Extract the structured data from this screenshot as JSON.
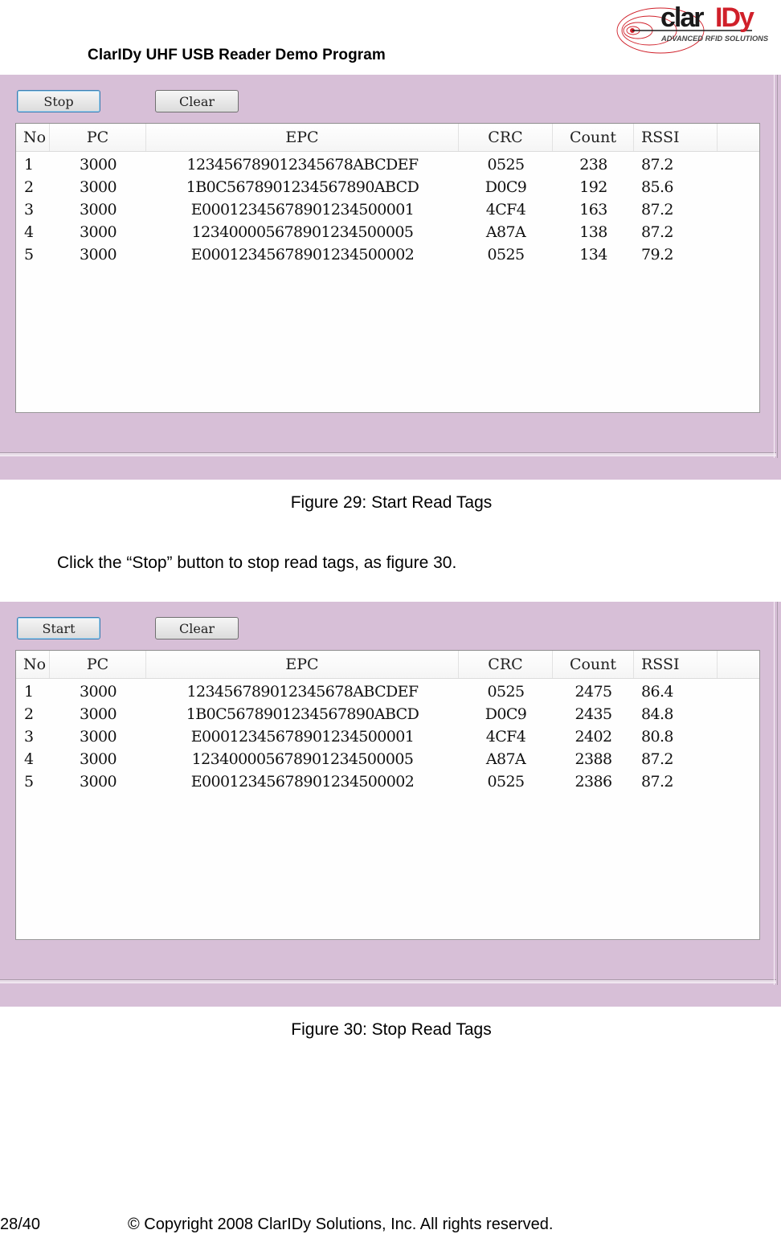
{
  "header": {
    "title": "ClarIDy UHF USB Reader Demo Program",
    "logo": {
      "brand_left": "clar",
      "brand_right": "IDy",
      "tagline": "ADVANCED RFID SOLUTIONS",
      "colors": {
        "dark": "#1a1a1a",
        "accent": "#d0202a"
      }
    }
  },
  "colors": {
    "panel_bg": "#d7bfd7",
    "primary_button_border": "#3c7fb1"
  },
  "table_columns": [
    "No",
    "PC",
    "EPC",
    "CRC",
    "Count",
    "RSSI",
    ""
  ],
  "figures": [
    {
      "toolbar": {
        "primary_label": "Stop",
        "clear_label": "Clear"
      },
      "columns": [
        "No",
        "PC",
        "EPC",
        "CRC",
        "Count",
        "RSSI",
        ""
      ],
      "rows": [
        {
          "no": "1",
          "pc": "3000",
          "epc": "12345678901234567 8ABCDEF",
          "crc": "0525",
          "count": "238",
          "rssi": "87.2"
        },
        {
          "no": "2",
          "pc": "3000",
          "epc": "1B0C5678901234567890ABCD",
          "crc": "D0C9",
          "count": "192",
          "rssi": "85.6"
        },
        {
          "no": "3",
          "pc": "3000",
          "epc": "E000123456789012345000 01",
          "crc": "4CF4",
          "count": "163",
          "rssi": "87.2"
        },
        {
          "no": "4",
          "pc": "3000",
          "epc": "123400005678901234500005",
          "crc": "A87A",
          "count": "138",
          "rssi": "87.2"
        },
        {
          "no": "5",
          "pc": "3000",
          "epc": "E00012345678901234500002",
          "crc": "0525",
          "count": "134",
          "rssi": "79.2"
        }
      ],
      "caption": "Figure 29: Start Read Tags"
    },
    {
      "toolbar": {
        "primary_label": "Start",
        "clear_label": "Clear"
      },
      "columns": [
        "No",
        "PC",
        "EPC",
        "CRC",
        "Count",
        "RSSI",
        ""
      ],
      "rows": [
        {
          "no": "1",
          "pc": "3000",
          "epc": "1234567890123456 78ABCDEF",
          "crc": "0525",
          "count": "2475",
          "rssi": "86.4"
        },
        {
          "no": "2",
          "pc": "3000",
          "epc": "1B0C5678901234567890ABCD",
          "crc": "D0C9",
          "count": "2435",
          "rssi": "84.8"
        },
        {
          "no": "3",
          "pc": "3000",
          "epc": "E00012345678901234500001",
          "crc": "4CF4",
          "count": "2402",
          "rssi": "80.8"
        },
        {
          "no": "4",
          "pc": "3000",
          "epc": "123400005678901234500005",
          "crc": "A87A",
          "count": "2388",
          "rssi": "87.2"
        },
        {
          "no": "5",
          "pc": "3000",
          "epc": "E00012345678901234500002",
          "crc": "0525",
          "count": "2386",
          "rssi": "87.2"
        }
      ],
      "caption": "Figure 30: Stop Read Tags"
    }
  ],
  "body_text": "Click the “Stop” button to stop read tags, as figure 30.",
  "footer": {
    "page": "28/40",
    "copyright": "© Copyright 2008 ClarIDy Solutions, Inc. All rights reserved."
  }
}
